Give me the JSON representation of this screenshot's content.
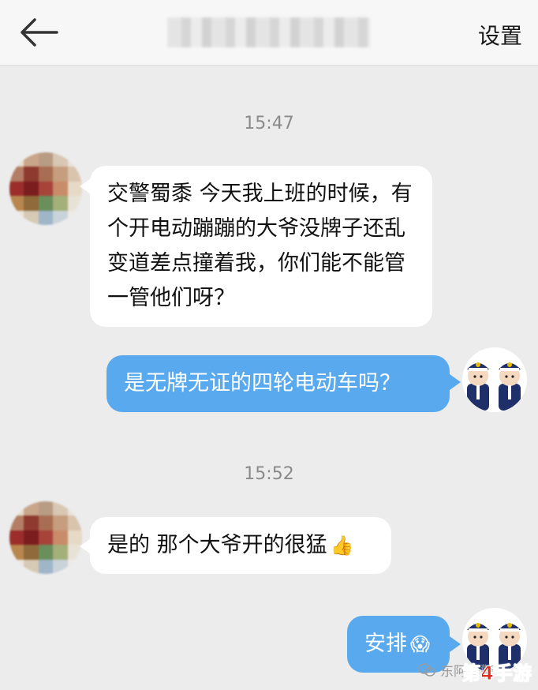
{
  "header": {
    "title_blurred": "",
    "settings_label": "设置"
  },
  "messages": [
    {
      "time": "15:47"
    },
    {
      "side": "left",
      "text": "交警蜀黍 今天我上班的时候，有个开电动蹦蹦的大爷没牌子还乱变道差点撞着我，你们能不能管一管他们呀？"
    },
    {
      "side": "right",
      "text": "是无牌无证的四轮电动车吗？"
    },
    {
      "time": "15:52"
    },
    {
      "side": "left",
      "text": "是的 那个大爷开的很猛",
      "emoji": "👍"
    },
    {
      "side": "right",
      "text": "安排",
      "emoji": "😱"
    }
  ],
  "watermark": {
    "left_text": "东阿交警",
    "right_text": "第4手游"
  },
  "colors": {
    "bubble_right": "#59a9ef",
    "bubble_left": "#ffffff",
    "background": "#ececec"
  },
  "icons": [
    "back-arrow-icon",
    "wechat-icon"
  ]
}
